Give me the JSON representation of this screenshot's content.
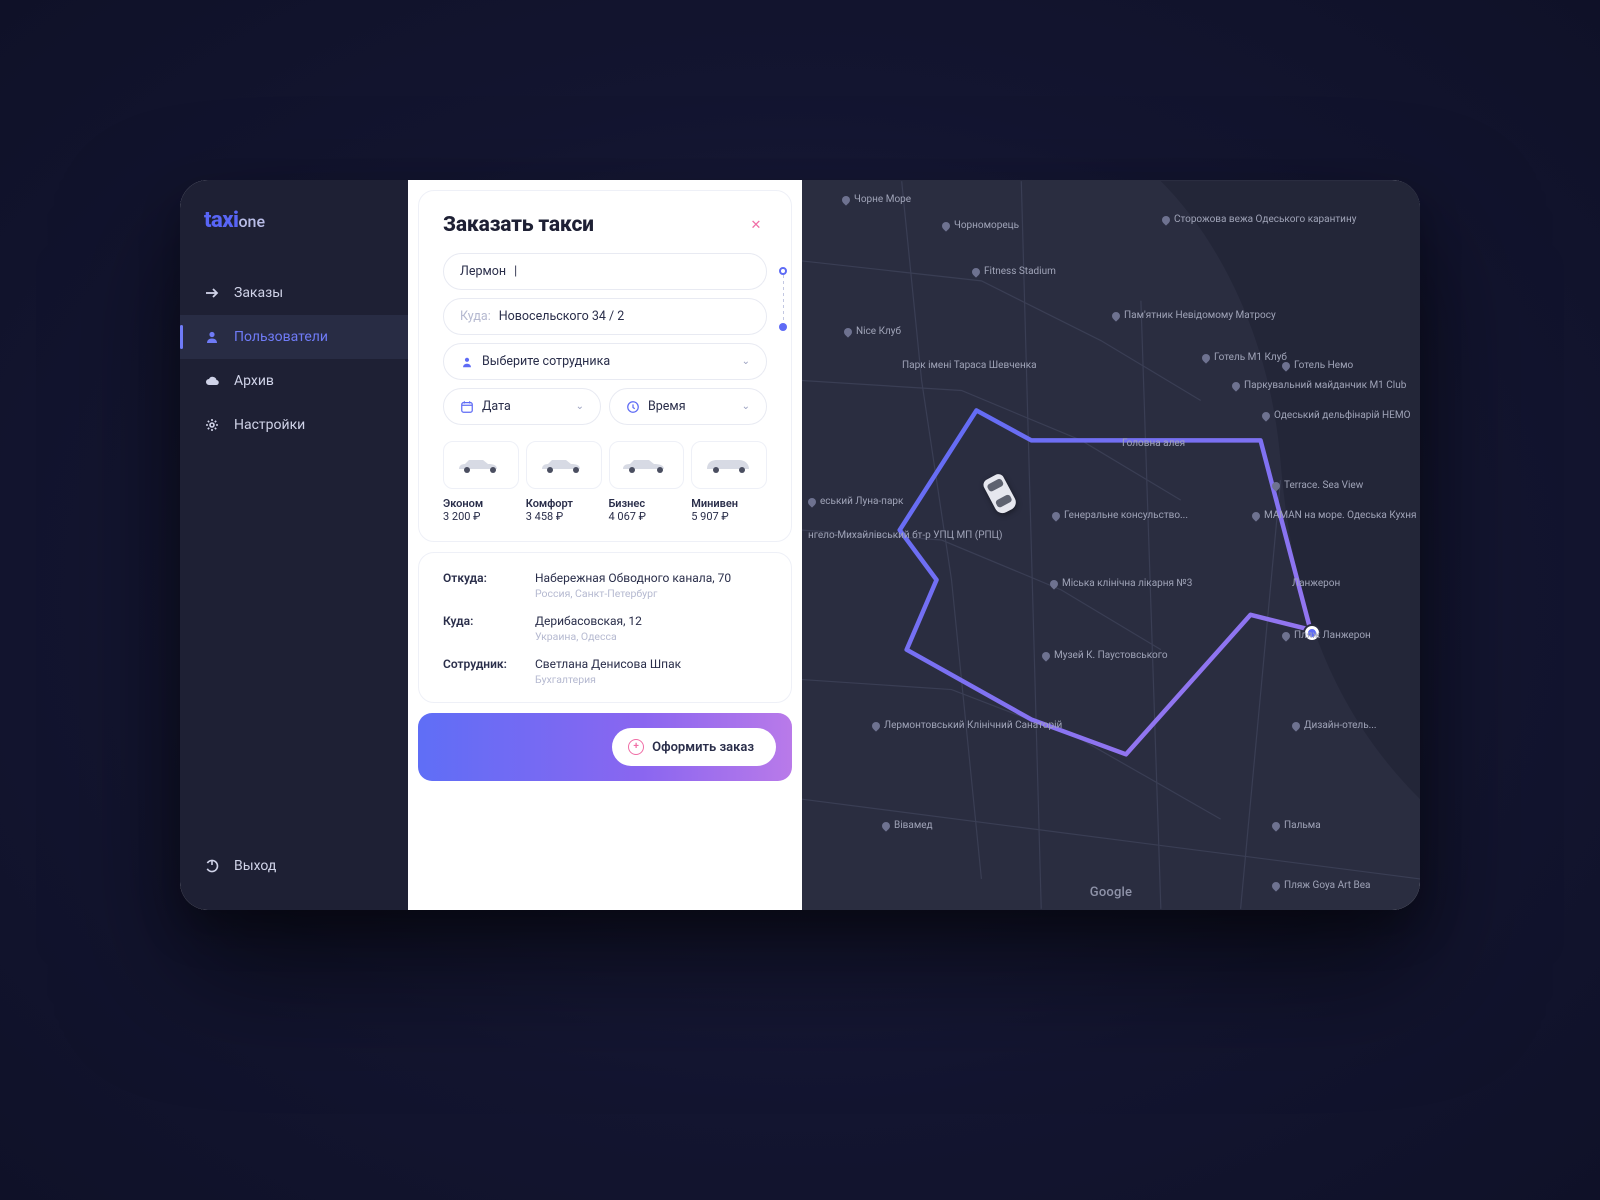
{
  "logo": {
    "prefix": "taxi",
    "suffix": "one"
  },
  "sidebar": {
    "items": [
      {
        "label": "Заказы",
        "icon": "arrow"
      },
      {
        "label": "Пользователи",
        "icon": "user",
        "active": true
      },
      {
        "label": "Архив",
        "icon": "cloud"
      },
      {
        "label": "Настройки",
        "icon": "gear"
      }
    ],
    "logout": "Выход"
  },
  "form": {
    "title": "Заказать такси",
    "from_value": "Лермон",
    "to_prefix": "Куда:",
    "to_value": "Новосельского 34 / 2",
    "employee_placeholder": "Выберите сотрудника",
    "date_label": "Дата",
    "time_label": "Время",
    "cars": [
      {
        "name": "Эконом",
        "price": "3 200 ₽"
      },
      {
        "name": "Комфорт",
        "price": "3 458 ₽"
      },
      {
        "name": "Бизнес",
        "price": "4 067 ₽"
      },
      {
        "name": "Минивен",
        "price": "5 907 ₽"
      }
    ]
  },
  "details": {
    "from_label": "Откуда:",
    "from_value": "Набережная Обводного канала, 70",
    "from_sub": "Россия, Санкт-Петербург",
    "to_label": "Куда:",
    "to_value": "Дерибасовская, 12",
    "to_sub": "Украина, Одесса",
    "emp_label": "Сотрудник:",
    "emp_value": "Светлана Денисова Шпак",
    "emp_sub": "Бухгалтерия"
  },
  "cta": {
    "label": "Оформить заказ"
  },
  "map": {
    "attribution": "Google",
    "labels": [
      "Чорне Море",
      "Чорноморець",
      "Сторожова вежа Одеського карантину",
      "Fitness Stadium",
      "Nice Клуб",
      "Пам'ятник Невідомому Матросу",
      "Парк імені Тараса Шевченка",
      "Готель М1 Клуб",
      "Паркувальний майданчик М1 Club",
      "Готель Немо",
      "Одеський дельфінарій НЕМО",
      "Головна алея",
      "Terrace. Sea View",
      "MAMAN на море. Одеська Кухня",
      "еський Луна-парк",
      "нгело-Михайлівський бт-р УПЦ МП (РПЦ)",
      "Генеральне консульство...",
      "Міська клінічна лікарня №3",
      "Ланжерон",
      "Пляж Ланжерон",
      "Музей К. Паустовського",
      "Лермонтовський Клінічний Санаторій",
      "Дизайн-отель...",
      "Вівамед",
      "Пальма",
      "Пляж Goya Art Bea"
    ]
  }
}
